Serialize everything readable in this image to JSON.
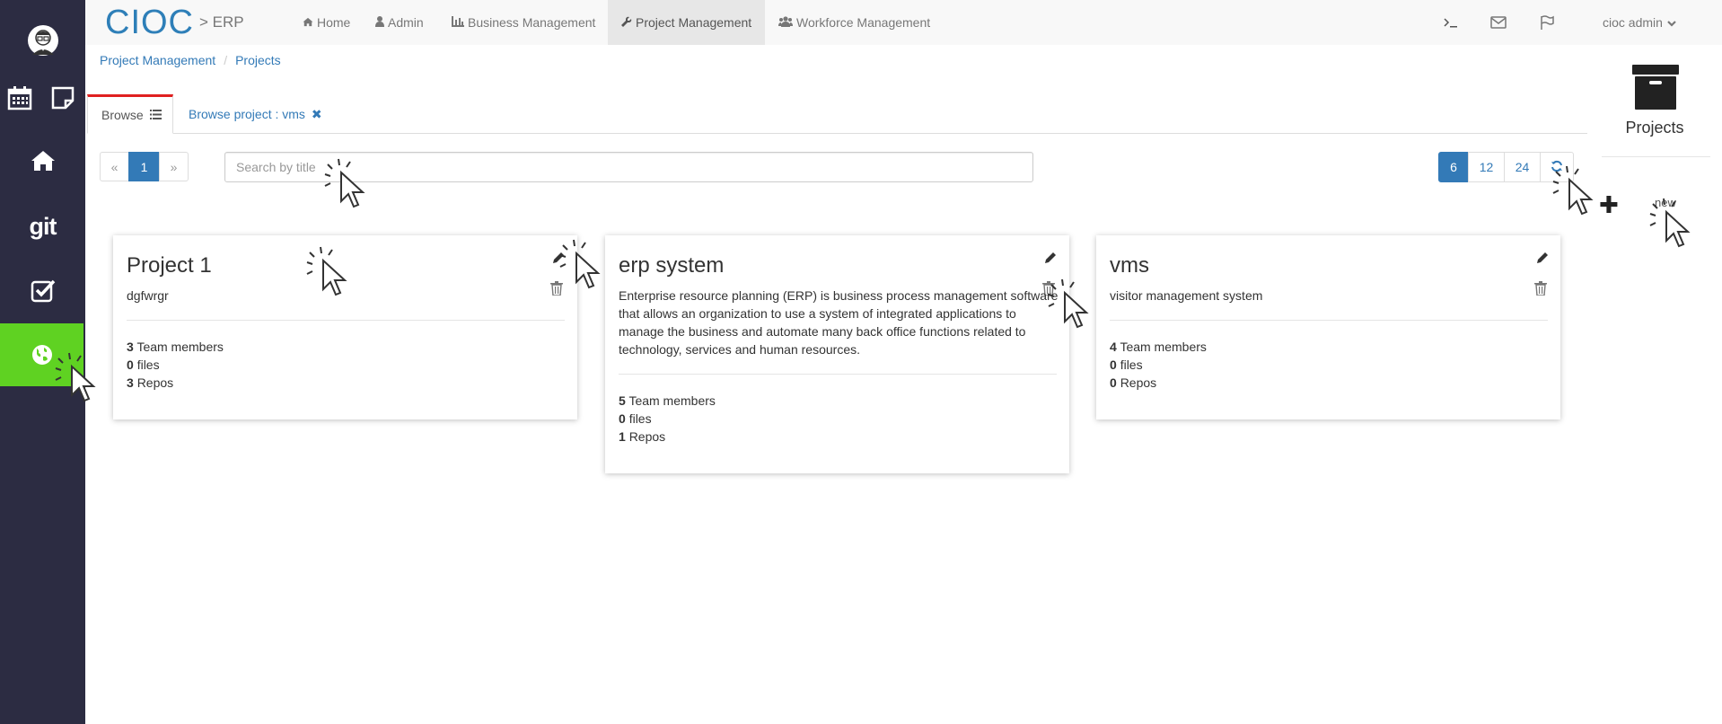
{
  "app": {
    "brand": "CIOC",
    "brand_sub": "> ERP"
  },
  "nav": {
    "items": [
      {
        "label": "Home",
        "icon": "home-icon"
      },
      {
        "label": "Admin",
        "icon": "user-icon"
      },
      {
        "label": "Business Management",
        "icon": "bar-chart-icon"
      },
      {
        "label": "Project Management",
        "icon": "wrench-icon",
        "active": true
      },
      {
        "label": "Workforce Management",
        "icon": "users-icon"
      }
    ],
    "user": "cioc admin"
  },
  "breadcrumb": [
    "Project Management",
    "Projects"
  ],
  "tabs": {
    "browse": "Browse",
    "vms": "Browse project : vms"
  },
  "pager": {
    "prev": "«",
    "current": "1",
    "next": "»"
  },
  "search": {
    "placeholder": "Search by title"
  },
  "page_sizes": [
    "6",
    "12",
    "24"
  ],
  "right_panel": {
    "title": "Projects",
    "new_label": "new"
  },
  "projects": [
    {
      "title": "Project 1",
      "description": "dgfwrgr",
      "team_members": "3",
      "files": "0",
      "repos": "3"
    },
    {
      "title": "erp system",
      "description": "Enterprise resource planning (ERP) is business process management software that allows an organization to use a system of integrated applications to manage the business and automate many back office functions related to technology, services and human resources.",
      "team_members": "5",
      "files": "0",
      "repos": "1"
    },
    {
      "title": "vms",
      "description": "visitor management system",
      "team_members": "4",
      "files": "0",
      "repos": "0"
    }
  ],
  "labels": {
    "team_members": "Team members",
    "files": "files",
    "repos": "Repos"
  },
  "colors": {
    "sidebar_bg": "#2c2c42",
    "sidebar_active": "#5fd222",
    "link": "#337ab7",
    "active_tab_border": "#e02020"
  }
}
